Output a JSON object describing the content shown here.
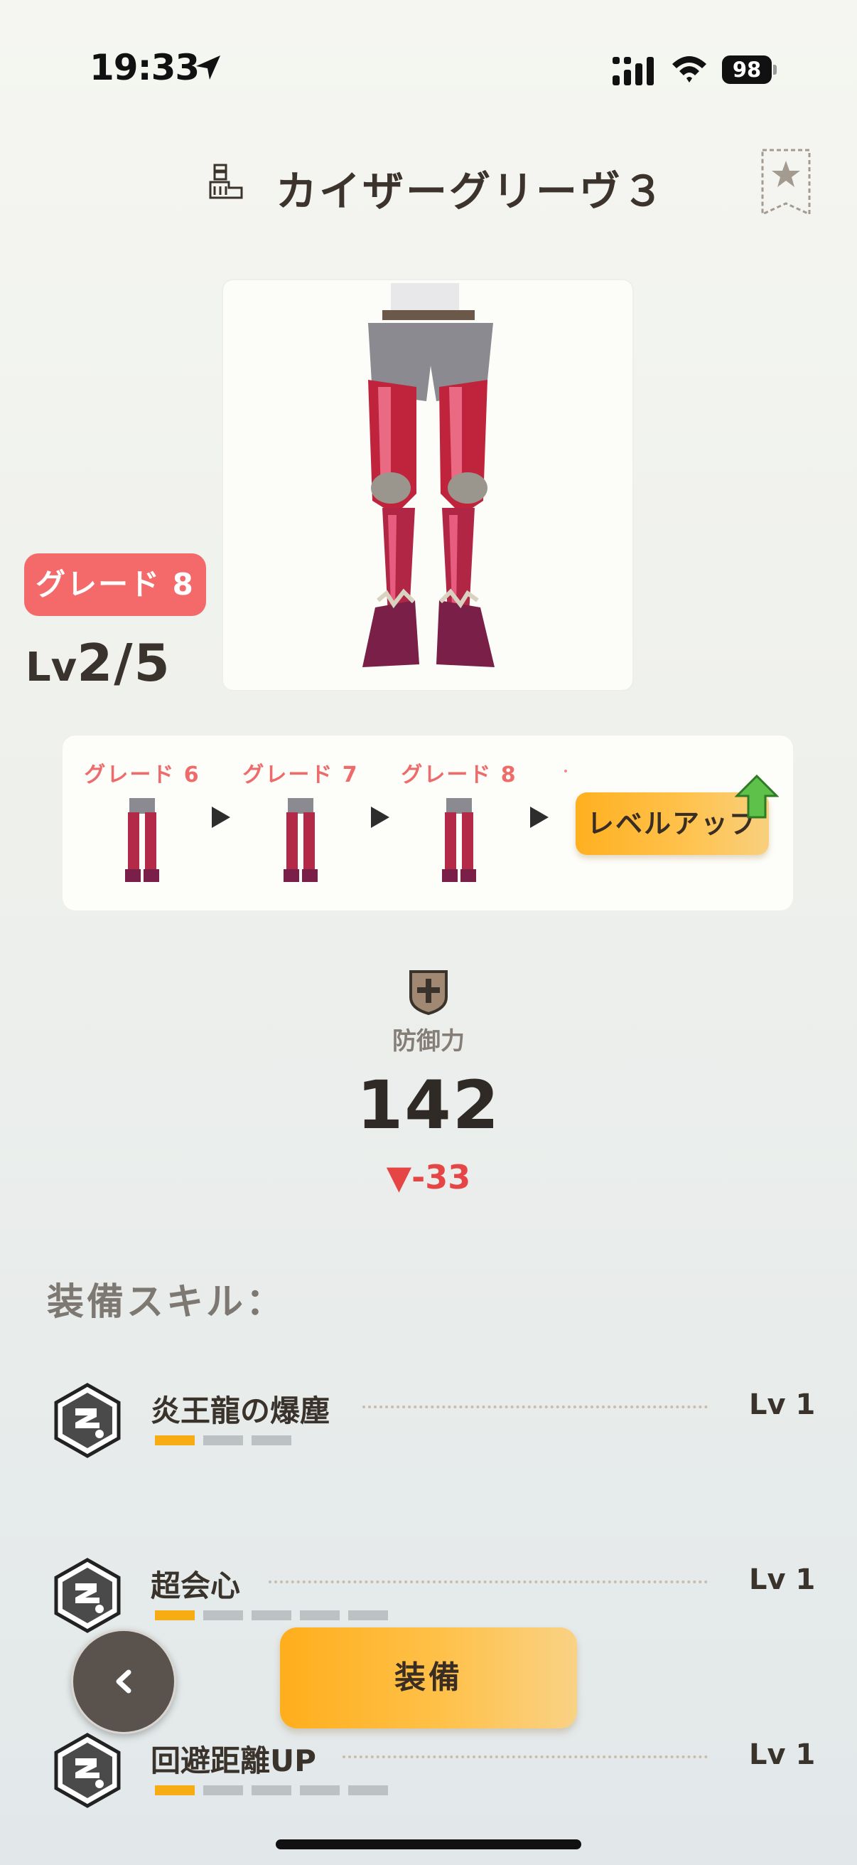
{
  "status_bar": {
    "time": "19:33",
    "battery": "98",
    "icons": [
      "location-arrow-icon",
      "signal-icon",
      "wifi-icon",
      "battery-icon"
    ]
  },
  "header": {
    "title": "カイザーグリーヴ３",
    "type_icon": "leg-armor-icon",
    "favorite_icon": "star-bookmark-icon"
  },
  "item": {
    "grade_badge": "グレード 8",
    "level_prefix": "Lv",
    "level_value": "2/5"
  },
  "grade_progression": {
    "steps": [
      {
        "label": "グレード 6"
      },
      {
        "label": "グレード 7"
      },
      {
        "label": "グレード 8"
      }
    ],
    "level_up_label": "レベルアップ"
  },
  "defense": {
    "label": "防御力",
    "value": "142",
    "diff": "▼-33",
    "icon": "shield-cross-icon"
  },
  "skills": {
    "title": "装備スキル：",
    "items": [
      {
        "name": "炎王龍の爆塵",
        "level": "Lv 1",
        "max_level": 3,
        "current_level": 1
      },
      {
        "name": "超会心",
        "level": "Lv 1",
        "max_level": 5,
        "current_level": 1
      },
      {
        "name": "回避距離UP",
        "level": "Lv 1",
        "max_level": 5,
        "current_level": 1
      }
    ]
  },
  "actions": {
    "equip_label": "装備",
    "back_icon": "chevron-left-icon"
  },
  "colors": {
    "accent_orange": "#FFB020",
    "grade_red": "#F46A6A",
    "diff_red": "#E64545"
  }
}
